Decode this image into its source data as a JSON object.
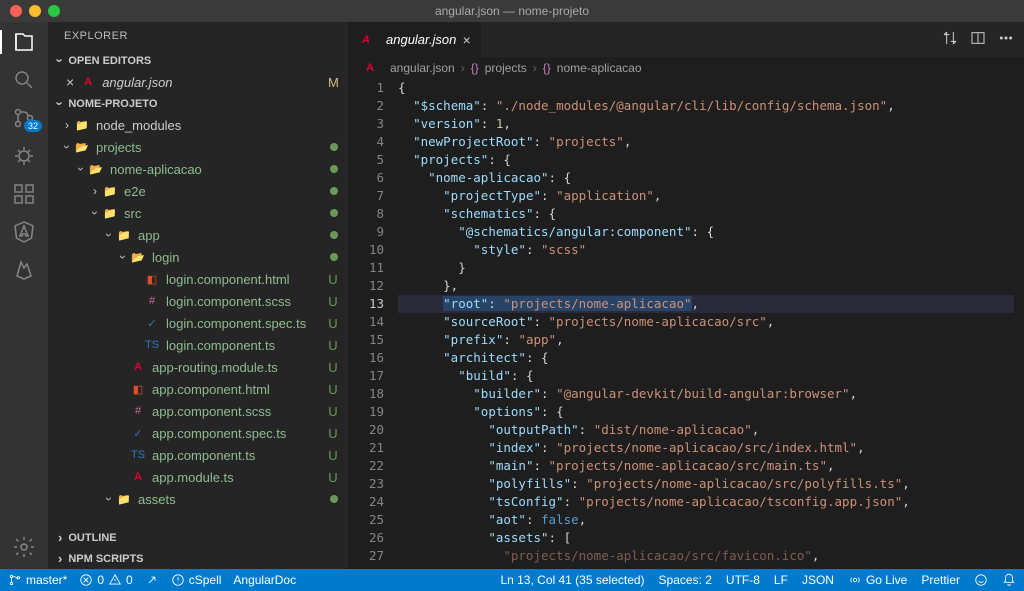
{
  "title": "angular.json — nome-projeto",
  "explorer": {
    "header": "EXPLORER"
  },
  "sections": {
    "openEditors": "OPEN EDITORS",
    "project": "NOME-PROJETO",
    "outline": "OUTLINE",
    "npm": "NPM SCRIPTS"
  },
  "openEditors": {
    "file": "angular.json",
    "status": "M"
  },
  "tree": [
    {
      "name": "node_modules",
      "indent": 0,
      "chev": "collapsed",
      "icon": "folder-green",
      "status": ""
    },
    {
      "name": "projects",
      "indent": 0,
      "chev": "open",
      "icon": "folder-open",
      "status": "dot"
    },
    {
      "name": "nome-aplicacao",
      "indent": 1,
      "chev": "open",
      "icon": "folder-open",
      "status": "dot"
    },
    {
      "name": "e2e",
      "indent": 2,
      "chev": "collapsed",
      "icon": "folder-teal",
      "status": "dot"
    },
    {
      "name": "src",
      "indent": 2,
      "chev": "open",
      "icon": "folder-green",
      "status": "dot"
    },
    {
      "name": "app",
      "indent": 3,
      "chev": "open",
      "icon": "folder-red",
      "status": "dot"
    },
    {
      "name": "login",
      "indent": 4,
      "chev": "open",
      "icon": "folder-open",
      "status": "dot"
    },
    {
      "name": "login.component.html",
      "indent": 5,
      "chev": "none",
      "icon": "html",
      "status": "U"
    },
    {
      "name": "login.component.scss",
      "indent": 5,
      "chev": "none",
      "icon": "scss",
      "status": "U"
    },
    {
      "name": "login.component.spec.ts",
      "indent": 5,
      "chev": "none",
      "icon": "spec",
      "status": "U"
    },
    {
      "name": "login.component.ts",
      "indent": 5,
      "chev": "none",
      "icon": "ts",
      "status": "U"
    },
    {
      "name": "app-routing.module.ts",
      "indent": 4,
      "chev": "none",
      "icon": "angular",
      "status": "U"
    },
    {
      "name": "app.component.html",
      "indent": 4,
      "chev": "none",
      "icon": "html",
      "status": "U"
    },
    {
      "name": "app.component.scss",
      "indent": 4,
      "chev": "none",
      "icon": "scss",
      "status": "U"
    },
    {
      "name": "app.component.spec.ts",
      "indent": 4,
      "chev": "none",
      "icon": "spec",
      "status": "U"
    },
    {
      "name": "app.component.ts",
      "indent": 4,
      "chev": "none",
      "icon": "ts",
      "status": "U"
    },
    {
      "name": "app.module.ts",
      "indent": 4,
      "chev": "none",
      "icon": "angular",
      "status": "U"
    },
    {
      "name": "assets",
      "indent": 3,
      "chev": "open",
      "icon": "folder-yellow",
      "status": "dot"
    }
  ],
  "tab": {
    "filename": "angular.json"
  },
  "breadcrumb": {
    "file": "angular.json",
    "part2": "projects",
    "part3": "nome-aplicacao"
  },
  "code": [
    {
      "t": "{",
      "i": 0
    },
    {
      "k": "$schema",
      "s": "./node_modules/@angular/cli/lib/config/schema.json",
      "i": 1,
      "c": true
    },
    {
      "k": "version",
      "n": "1",
      "i": 1,
      "c": true
    },
    {
      "k": "newProjectRoot",
      "s": "projects",
      "i": 1,
      "c": true
    },
    {
      "k": "projects",
      "open": "{",
      "i": 1
    },
    {
      "k": "nome-aplicacao",
      "open": "{",
      "i": 2
    },
    {
      "k": "projectType",
      "s": "application",
      "i": 3,
      "c": true
    },
    {
      "k": "schematics",
      "open": "{",
      "i": 3
    },
    {
      "k": "@schematics/angular:component",
      "open": "{",
      "i": 4
    },
    {
      "k": "style",
      "s": "scss",
      "i": 5
    },
    {
      "t": "}",
      "i": 4
    },
    {
      "t": "},",
      "i": 3
    },
    {
      "k": "root",
      "s": "projects/nome-aplicacao",
      "i": 3,
      "c": true,
      "hl": true,
      "sel": true
    },
    {
      "k": "sourceRoot",
      "s": "projects/nome-aplicacao/src",
      "i": 3,
      "c": true
    },
    {
      "k": "prefix",
      "s": "app",
      "i": 3,
      "c": true
    },
    {
      "k": "architect",
      "open": "{",
      "i": 3
    },
    {
      "k": "build",
      "open": "{",
      "i": 4
    },
    {
      "k": "builder",
      "s": "@angular-devkit/build-angular:browser",
      "i": 5,
      "c": true
    },
    {
      "k": "options",
      "open": "{",
      "i": 5
    },
    {
      "k": "outputPath",
      "s": "dist/nome-aplicacao",
      "i": 6,
      "c": true
    },
    {
      "k": "index",
      "s": "projects/nome-aplicacao/src/index.html",
      "i": 6,
      "c": true
    },
    {
      "k": "main",
      "s": "projects/nome-aplicacao/src/main.ts",
      "i": 6,
      "c": true
    },
    {
      "k": "polyfills",
      "s": "projects/nome-aplicacao/src/polyfills.ts",
      "i": 6,
      "c": true
    },
    {
      "k": "tsConfig",
      "s": "projects/nome-aplicacao/tsconfig.app.json",
      "i": 6,
      "c": true
    },
    {
      "k": "aot",
      "b": "false",
      "i": 6,
      "c": true
    },
    {
      "k": "assets",
      "open": "[",
      "i": 6
    },
    {
      "sOnly": "projects/nome-aplicacao/src/favicon.ico",
      "i": 7,
      "c": true,
      "dim": true
    }
  ],
  "statusbar": {
    "branch": "master*",
    "errors": "0",
    "warnings": "0",
    "cspell": "cSpell",
    "angulardoc": "AngularDoc",
    "cursor": "Ln 13, Col 41 (35 selected)",
    "spaces": "Spaces: 2",
    "encoding": "UTF-8",
    "eol": "LF",
    "lang": "JSON",
    "golive": "Go Live",
    "prettier": "Prettier"
  },
  "scmBadge": "32"
}
